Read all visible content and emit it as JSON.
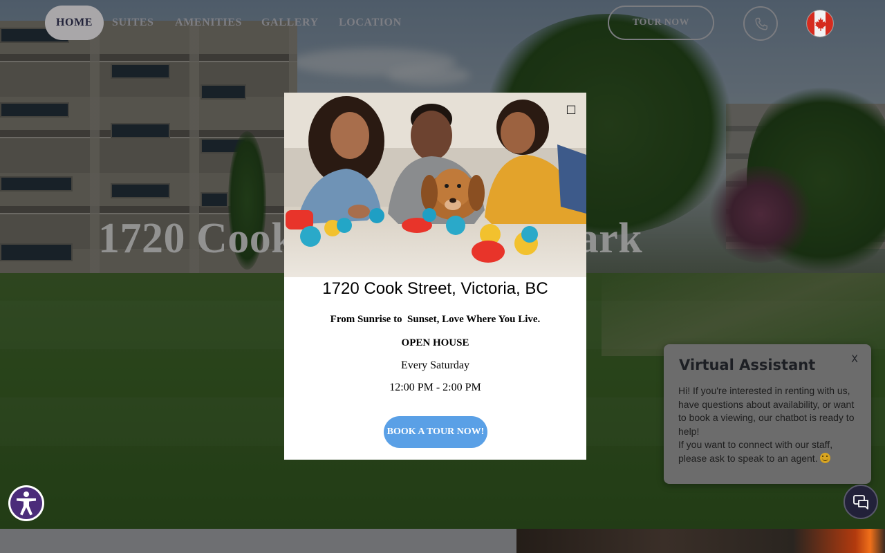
{
  "nav": {
    "items": [
      {
        "label": "HOME",
        "active": true
      },
      {
        "label": "SUITES",
        "active": false
      },
      {
        "label": "AMENITIES",
        "active": false
      },
      {
        "label": "GALLERY",
        "active": false
      },
      {
        "label": "LOCATION",
        "active": false
      }
    ],
    "tour_label": "TOUR NOW",
    "phone_icon": "phone-icon",
    "language_icon": "canada-flag-icon"
  },
  "hero": {
    "title": "1720 Cook Street North Park"
  },
  "modal": {
    "close_glyph": "□",
    "address": "1720 Cook Street, Victoria, BC",
    "tagline": "From Sunrise to  Sunset, Love Where You Live.",
    "open_house": "OPEN HOUSE",
    "day": "Every Saturday",
    "time": "12:00 PM - 2:00 PM",
    "cta": "BOOK A TOUR NOW!",
    "cta_color": "#5aa0e6"
  },
  "assistant": {
    "title": "Virtual Assistant",
    "close_label": "X",
    "message_1": "Hi! If you're interested in renting with us, have questions about availability, or want to book a viewing, our chatbot is ready to help!",
    "message_2": "If you want to connect with our staff, please ask to speak to an agent.",
    "emoji_icon": "smiley-icon",
    "chat_icon": "chat-bubbles-icon"
  },
  "accessibility": {
    "icon": "accessibility-person-icon",
    "color": "#4b2c7a"
  }
}
